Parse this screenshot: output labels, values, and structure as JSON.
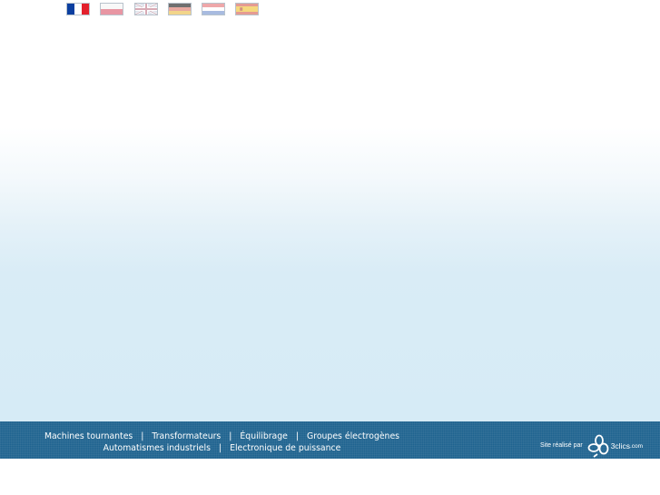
{
  "languages": [
    {
      "code": "fr",
      "icon": "france-flag-icon"
    },
    {
      "code": "pl",
      "icon": "poland-flag-icon"
    },
    {
      "code": "en",
      "icon": "united-kingdom-flag-icon"
    },
    {
      "code": "de",
      "icon": "germany-flag-icon"
    },
    {
      "code": "nl",
      "icon": "netherlands-flag-icon"
    },
    {
      "code": "es",
      "icon": "spain-flag-icon"
    }
  ],
  "footer": {
    "separator": "|",
    "links_row1": [
      "Machines tournantes",
      "Transformateurs",
      "Équilibrage",
      "Groupes électrogènes"
    ],
    "links_row2": [
      "Automatismes industriels",
      "Electronique de puissance"
    ]
  },
  "credit": {
    "text": "Site réalisé par",
    "logo_name": "3clics",
    "logo_tld": ".com"
  },
  "colors": {
    "footer_bg": "#1f638f",
    "page_gradient_bottom": "#d6ebf6"
  }
}
